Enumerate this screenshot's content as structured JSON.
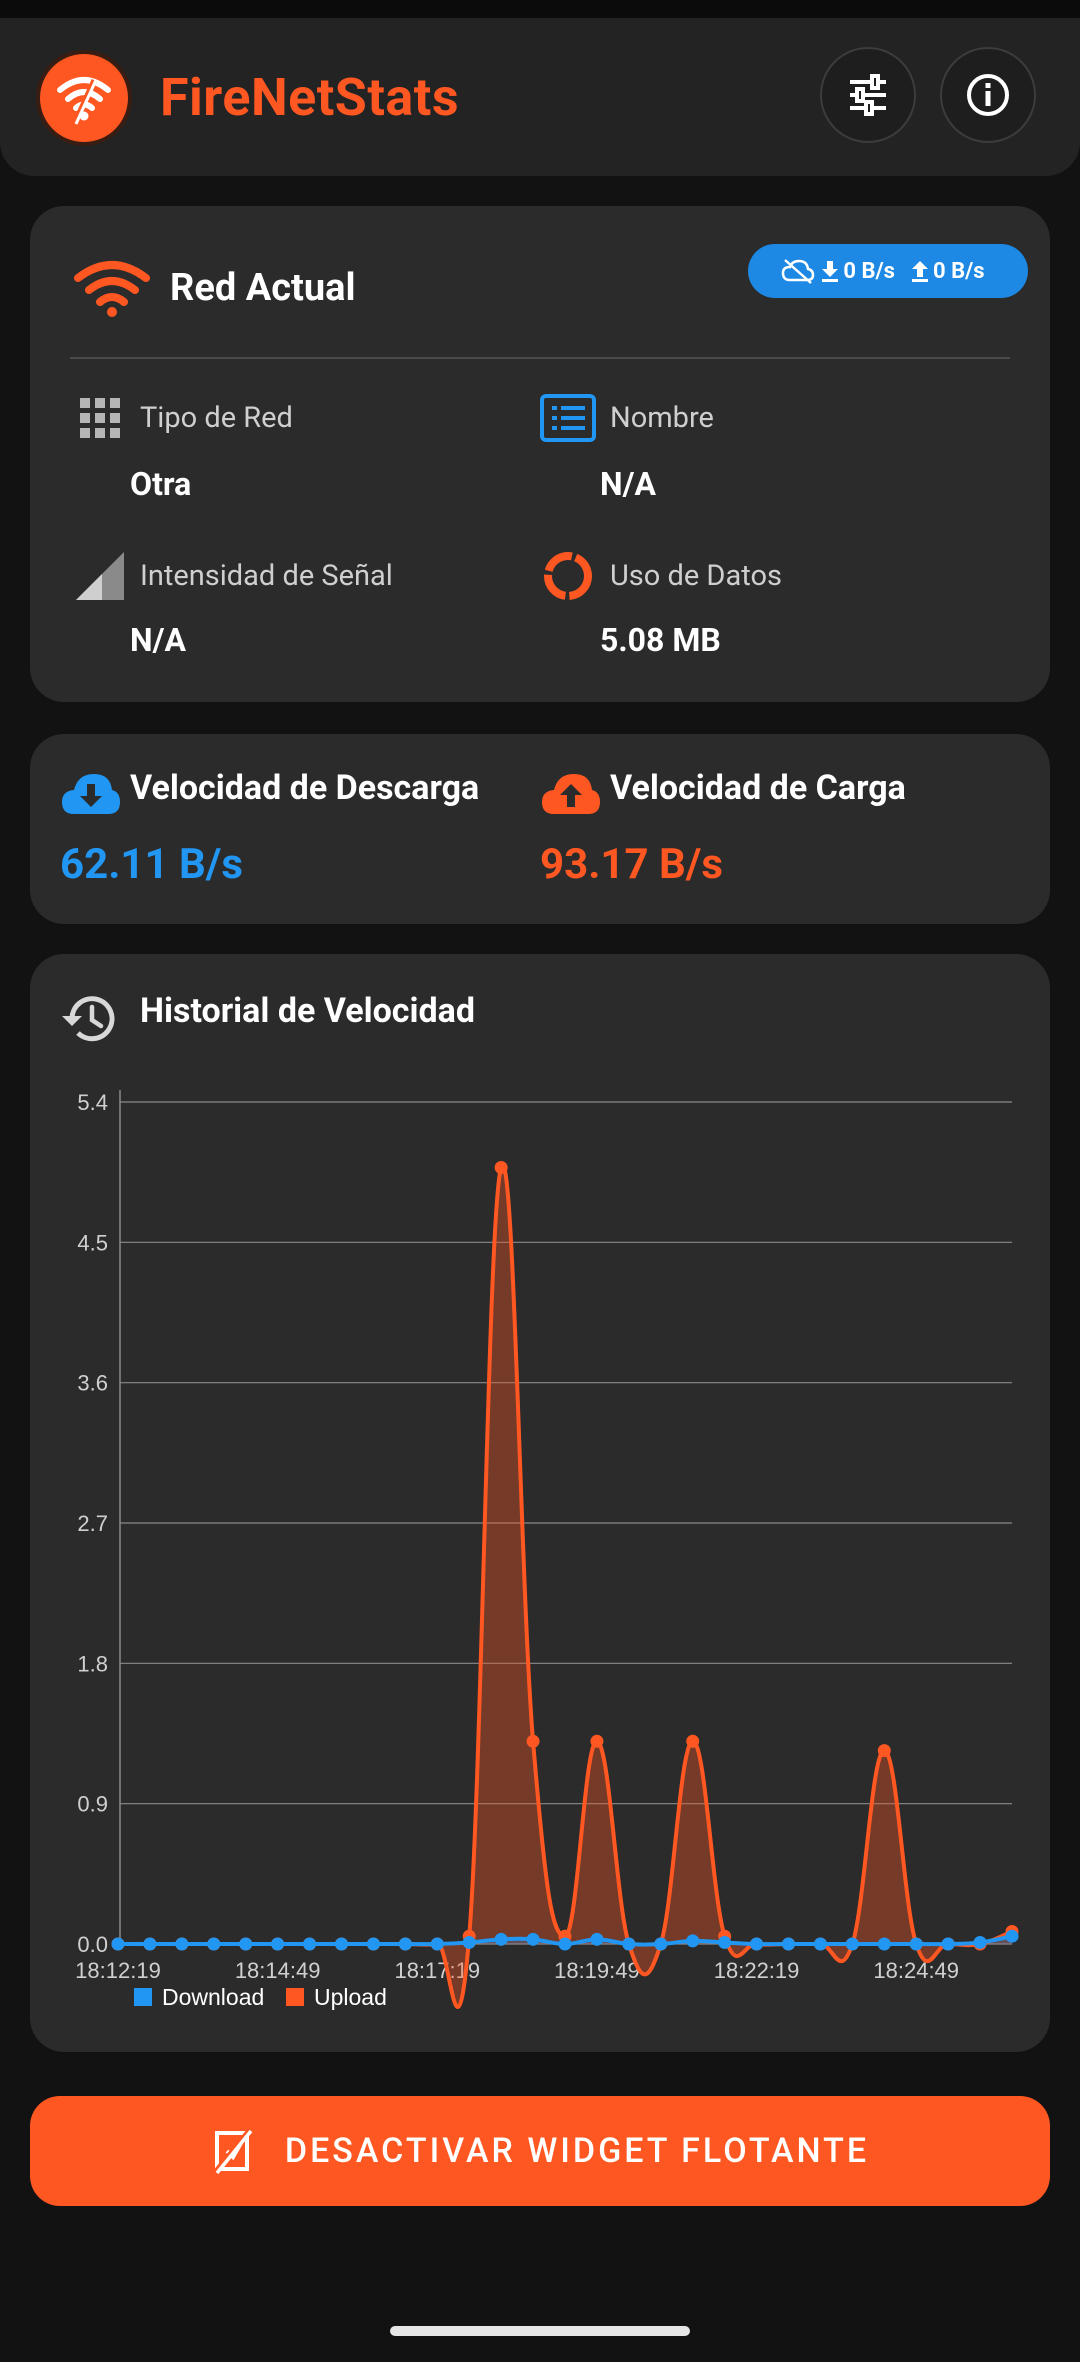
{
  "app": {
    "title": "FireNetStats",
    "accent_color": "#ff5722",
    "download_color": "#2196f3",
    "logo_icon": "wifi-flame-logo-icon",
    "settings_icon": "tune-sliders-icon",
    "info_icon": "info-circle-icon"
  },
  "network_card": {
    "title": "Red Actual",
    "title_icon": "wifi-icon",
    "badge": {
      "icon": "cloud-off-icon",
      "download": "0 B/s",
      "upload": "0 B/s"
    },
    "items": [
      {
        "label": "Tipo de Red",
        "value": "Otra",
        "icon": "grid-icon"
      },
      {
        "label": "Nombre",
        "value": "N/A",
        "icon": "list-box-icon"
      },
      {
        "label": "Intensidad de Señal",
        "value": "N/A",
        "icon": "signal-icon"
      },
      {
        "label": "Uso de Datos",
        "value": "5.08 MB",
        "icon": "donut-icon"
      }
    ]
  },
  "speed_card": {
    "download": {
      "label": "Velocidad de Descarga",
      "value": "62.11 B/s",
      "icon": "cloud-download-icon"
    },
    "upload": {
      "label": "Velocidad de Carga",
      "value": "93.17 B/s",
      "icon": "cloud-upload-icon"
    }
  },
  "history_card": {
    "title": "Historial de Velocidad",
    "icon": "history-icon"
  },
  "chart_data": {
    "type": "area",
    "title": "",
    "xlabel": "",
    "ylabel": "",
    "ylim": [
      0,
      5.4
    ],
    "y_ticks": [
      "0.0",
      "0.9",
      "1.8",
      "2.7",
      "3.6",
      "4.5",
      "5.4"
    ],
    "x_tick_labels": [
      "18:12:19",
      "18:14:49",
      "18:17:19",
      "18:19:49",
      "18:22:19",
      "18:24:49"
    ],
    "x_tick_indices": [
      0,
      5,
      10,
      15,
      20,
      25
    ],
    "grid": true,
    "legend_position": "bottom-left",
    "series": [
      {
        "name": "Download",
        "color": "#2196f3",
        "values": [
          0,
          0,
          0,
          0,
          0,
          0,
          0,
          0,
          0,
          0,
          0,
          0.01,
          0.03,
          0.03,
          0,
          0.03,
          0,
          0,
          0.02,
          0.01,
          0,
          0,
          0,
          0,
          0,
          0,
          0,
          0.01,
          0.05
        ]
      },
      {
        "name": "Upload",
        "color": "#ff5722",
        "values": [
          0,
          0,
          0,
          0,
          0,
          0,
          0,
          0,
          0,
          0,
          0,
          0.05,
          4.98,
          1.3,
          0.05,
          1.3,
          0,
          0,
          1.3,
          0.05,
          0,
          0,
          0,
          0,
          1.24,
          0,
          0,
          0,
          0.08
        ]
      }
    ]
  },
  "cta": {
    "label": "DESACTIVAR WIDGET FLOTANTE",
    "icon": "widget-off-icon"
  }
}
